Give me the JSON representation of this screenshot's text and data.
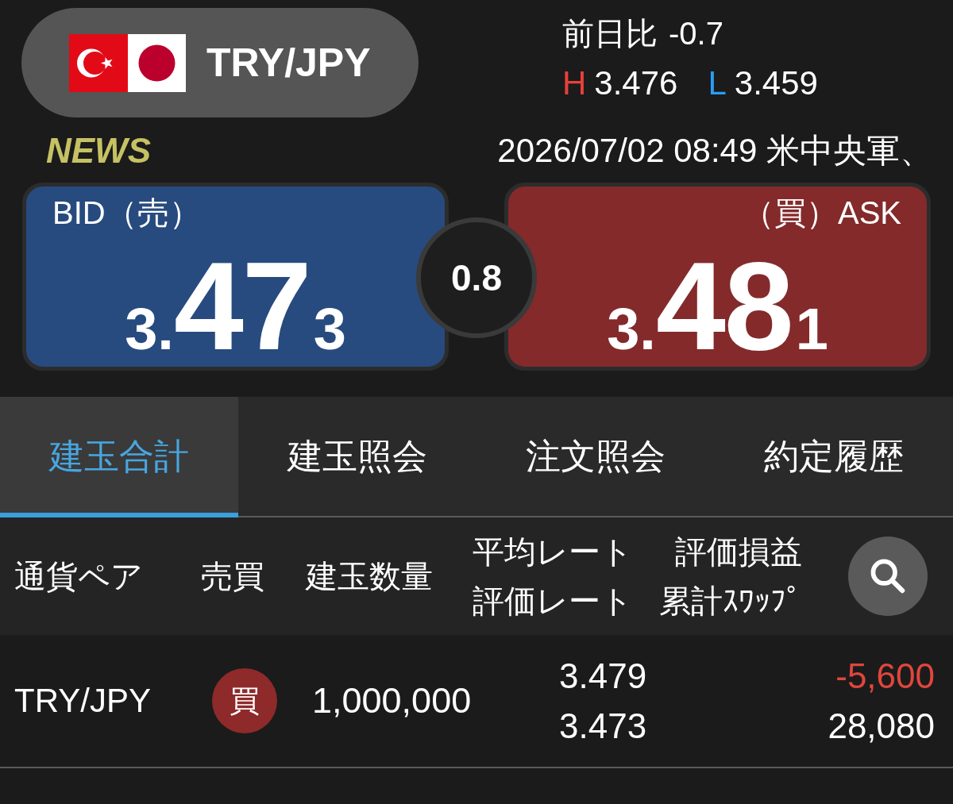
{
  "pair_selector": {
    "label": "TRY/JPY"
  },
  "daily_change": {
    "label": "前日比",
    "value": "-0.7"
  },
  "high_low": [
    {
      "kind": "high",
      "label": "H",
      "value": "3.476"
    },
    {
      "kind": "low",
      "label": "L",
      "value": "3.459"
    }
  ],
  "news": {
    "label": "NEWS",
    "headline": "2026/07/02 08:49 米中央軍、"
  },
  "quotes": [
    {
      "kind": "bid",
      "label": "BID（売）",
      "price_head": "3.",
      "price_big": "47",
      "price_tail": "3"
    },
    {
      "kind": "ask",
      "label": "（買）ASK",
      "price_head": "3.",
      "price_big": "48",
      "price_tail": "1"
    }
  ],
  "spread": "0.8",
  "tabs": [
    {
      "label": "建玉合計",
      "selected": true
    },
    {
      "label": "建玉照会",
      "selected": false
    },
    {
      "label": "注文照会",
      "selected": false
    },
    {
      "label": "約定履歴",
      "selected": false
    }
  ],
  "table": {
    "columns": [
      {
        "lines": [
          "通貨ペア"
        ]
      },
      {
        "lines": [
          "売買"
        ]
      },
      {
        "lines": [
          "建玉数量"
        ]
      },
      {
        "lines": [
          "平均レート",
          "評価レート"
        ]
      },
      {
        "lines": [
          "評価損益",
          "累計ｽﾜｯﾌﾟ"
        ]
      }
    ],
    "rows": [
      {
        "pair": "TRY/JPY",
        "side": {
          "kind": "buy",
          "label": "買"
        },
        "quantity": "1,000,000",
        "average_rate": "3.479",
        "valuation_rate": "3.473",
        "profit_loss": "-5,600",
        "loss": true,
        "swap": "28,080"
      }
    ]
  }
}
